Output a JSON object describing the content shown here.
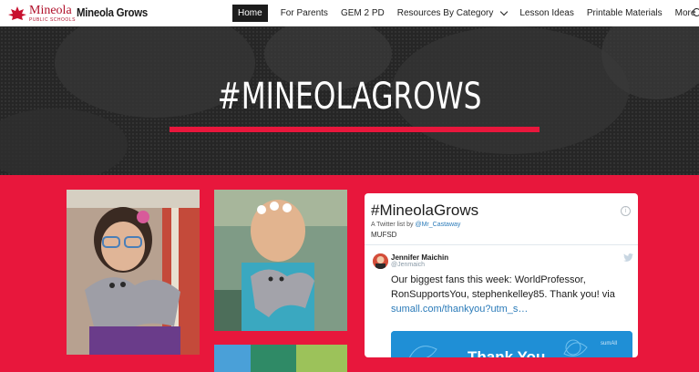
{
  "header": {
    "logo_main": "Mineola",
    "logo_sub": "PUBLIC SCHOOLS",
    "site_title": "Mineola Grows",
    "nav": [
      {
        "label": "Home",
        "active": true
      },
      {
        "label": "For Parents"
      },
      {
        "label": "GEM 2 PD"
      },
      {
        "label": "Resources By Category",
        "dropdown": true
      },
      {
        "label": "Lesson Ideas"
      },
      {
        "label": "Printable Materials"
      },
      {
        "label": "More",
        "dropdown": true
      }
    ]
  },
  "hero": {
    "title": "#MINEOLAGROWS"
  },
  "twitter": {
    "title": "#MineolaGrows",
    "list_by_prefix": "A Twitter list by ",
    "list_by_user": "@Mr_Castaway",
    "list_name": "MUFSD",
    "tweet": {
      "author": "Jennifer Maichin",
      "handle": "@Jenmaich",
      "text": "Our biggest fans this week: WorldProfessor, RonSupportsYou, stephenkelley85. Thank you! via",
      "link": "sumall.com/thankyou?utm_s…"
    },
    "card_text": "Thank You",
    "card_brand": "sumAll"
  },
  "colors": {
    "brand_red": "#e8173c",
    "hero_dark": "#2b2b2b",
    "link_blue": "#2b7bb9"
  }
}
